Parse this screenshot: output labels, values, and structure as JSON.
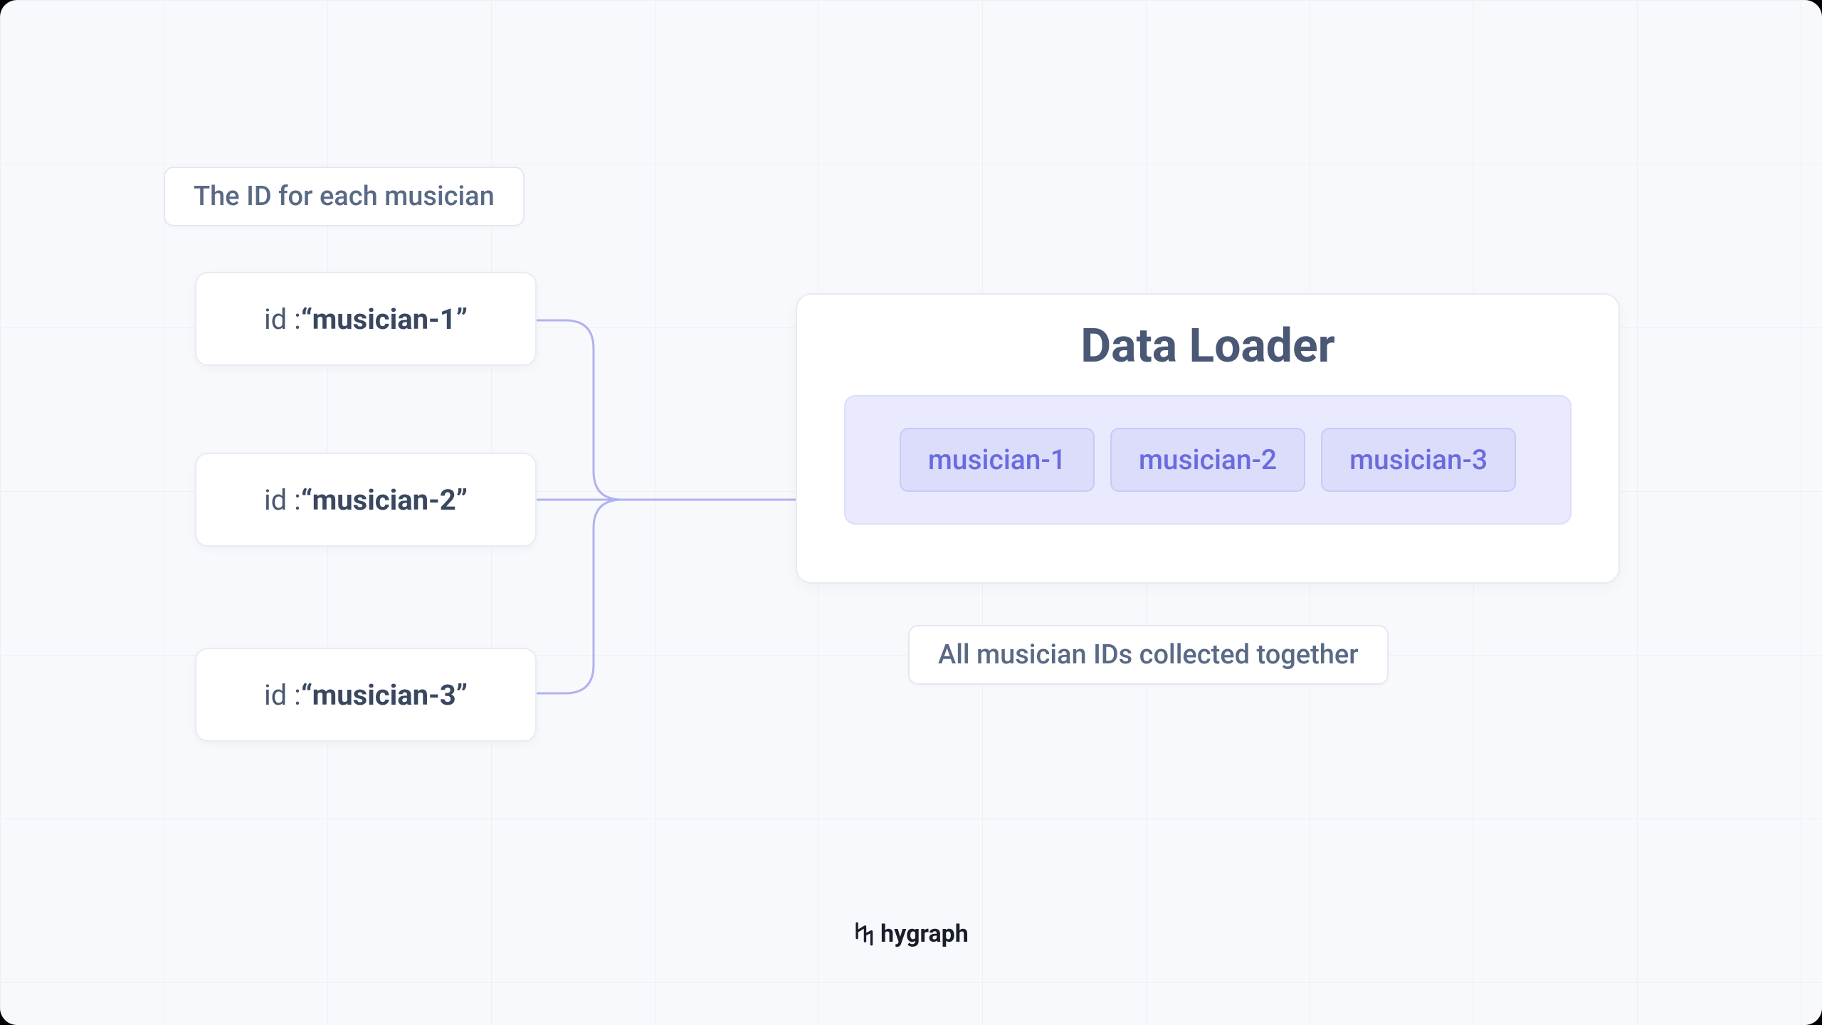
{
  "labels": {
    "top": "The ID for each musician",
    "bottom": "All musician IDs collected together"
  },
  "id_prefix": "id : ",
  "ids": [
    "“musician-1”",
    "“musician-2”",
    "“musician-3”"
  ],
  "loader": {
    "title": "Data Loader",
    "chips": [
      "musician-1",
      "musician-2",
      "musician-3"
    ]
  },
  "brand": "hygraph",
  "colors": {
    "connector": "#b0b2ef",
    "text": "#4a5875",
    "chip_bg": "#dcdcfb",
    "chip_text": "#6a6be0"
  }
}
